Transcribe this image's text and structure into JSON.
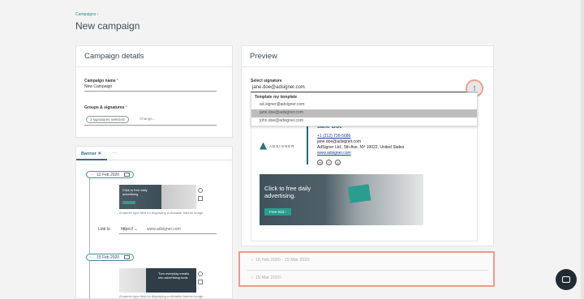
{
  "breadcrumb": "Campaigns ›",
  "page_title": "New campaign",
  "details": {
    "heading": "Campaign details",
    "name_label": "Campaign name",
    "name_value": "New Campaign",
    "groups_label": "Groups & signatures",
    "required_mark": "*",
    "chip": "2 signatures selected",
    "change_link": "Change..."
  },
  "banner_card": {
    "tab_label": "Banner ✕",
    "tab_more": "···",
    "entries": [
      {
        "date": "12 Feb 2020",
        "dots": "···",
        "banner_text": "Click to free daily advertising",
        "caption": "A banner type field for displaying a clickable banner image.",
        "link_label": "Link to",
        "link_proto": "https:// ⌄",
        "link_url": "www.adsigner.com"
      },
      {
        "date": "15 Feb 2020",
        "dots": "···",
        "banner_text": "Turn everyday emails into advertising tools",
        "caption": "A banner type field for displaying a clickable banner image."
      }
    ]
  },
  "preview": {
    "heading": "Preview",
    "select_label": "Select signature",
    "select_value": "jane.doe@adsigner.com",
    "menu_icon": "⋮",
    "dropdown_header": "Template my template",
    "dropdown_items": [
      "ad.signer@adsigner.com",
      "jane.doe@adsigner.com",
      "john.doe@adsigner.com"
    ],
    "signature": {
      "name": "Jane Doe",
      "phone": "+1 (212) 736-5686",
      "email": "jane.doe@adsigner.com",
      "address": "AdSigner Ltd., 5th Ave, NY 10022, United States",
      "website": "www.adsigner.com",
      "logo_text": "ADSIGNER",
      "socials": [
        "in",
        "f",
        "◎"
      ]
    },
    "banner": {
      "text": "Click to free daily advertising.",
      "button": "Free trial ›"
    }
  },
  "accordion": {
    "rows": [
      "16 Feb 2020 - 15 Mar 2020",
      "15 Mar 2020 -"
    ]
  },
  "colors": {
    "accent": "#2f6f8a",
    "teal": "#2a9d8f",
    "highlight": "#ef9a8c"
  }
}
